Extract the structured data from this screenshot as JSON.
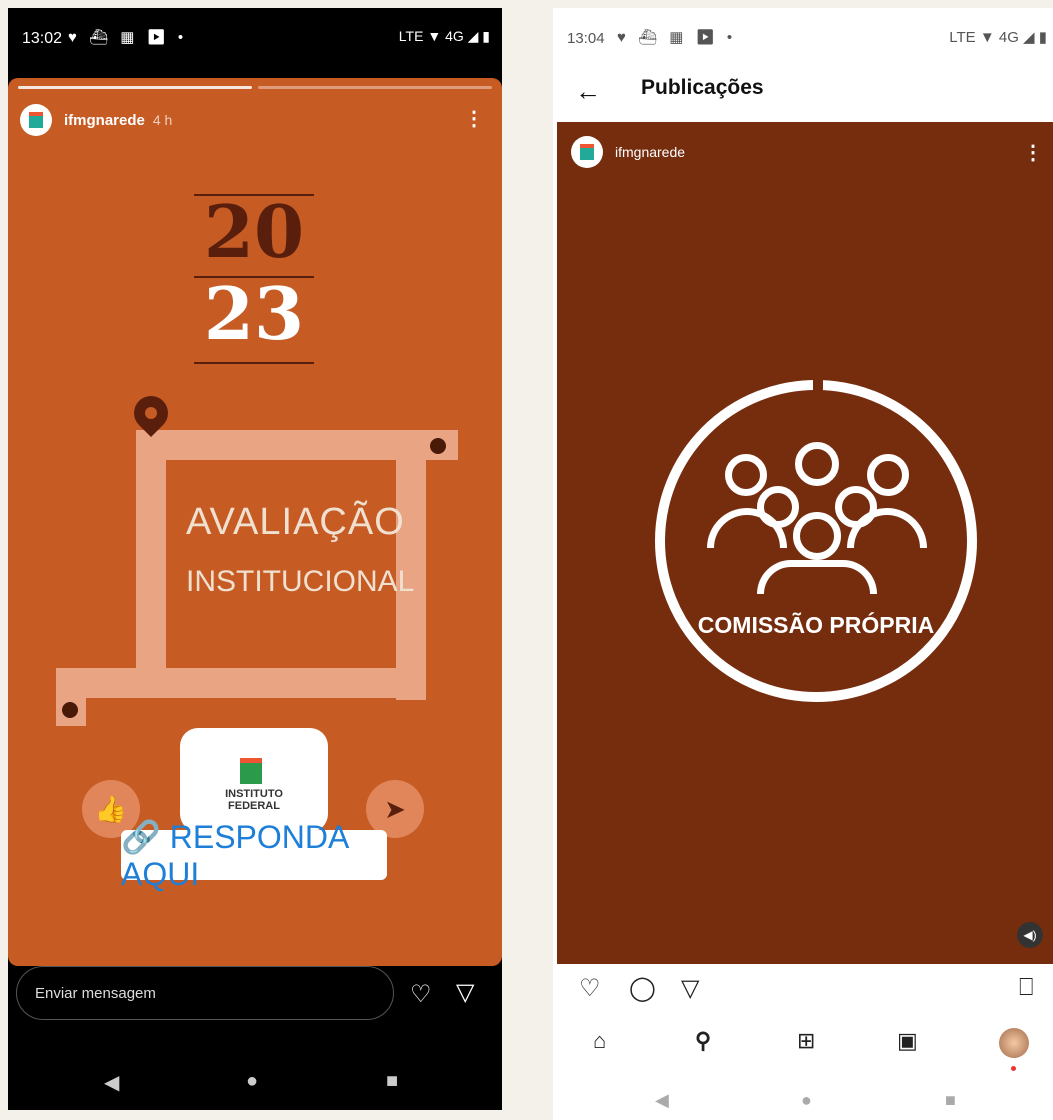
{
  "left": {
    "status": {
      "time": "13:02",
      "icons": "♥ ⛴ ▦ ▶ •",
      "right_icons": "LTE ▼ 4G ◢ ▮"
    },
    "story": {
      "username": "ifmgnarede",
      "time_ago": "4 h",
      "year_top": "20",
      "year_bottom": "23",
      "title_line1": "AVALIAÇÃO",
      "title_line2": "INSTITUCIONAL",
      "logo_text_line1": "INSTITUTO",
      "logo_text_line2": "FEDERAL",
      "link_label": "🔗 RESPONDA AQUI"
    },
    "reply_placeholder": "Enviar mensagem"
  },
  "right": {
    "status": {
      "time": "13:04",
      "icons": "♥ ⛴ ▦ ▶ •",
      "right_icons": "LTE ▼ 4G ◢ ▮"
    },
    "page_title": "Publicações",
    "post": {
      "username": "ifmgnarede",
      "caption_graphic_text": "COMISSÃO PRÓPRIA"
    }
  },
  "icons": {
    "back": "←",
    "kebab": "⋮",
    "heart": "♡",
    "comment": "◯",
    "send": "▽",
    "bookmark": "⎕",
    "home": "⌂",
    "search": "⚲",
    "add": "⊞",
    "reels": "▣",
    "mute": "◀)",
    "nav_back": "◀",
    "nav_home": "●",
    "nav_recent": "■",
    "like_thumb": "👍",
    "paper_plane": "➤"
  }
}
